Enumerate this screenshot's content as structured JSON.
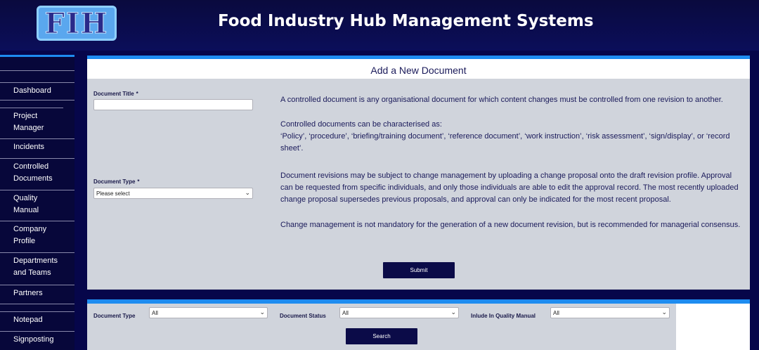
{
  "header": {
    "logo_text": "FIH",
    "title": "Food Industry Hub Management Systems"
  },
  "sidebar": {
    "items": [
      {
        "label": "Dashboard"
      },
      {
        "label": "Project Manager"
      },
      {
        "label": "Incidents"
      },
      {
        "label": "Controlled Documents"
      },
      {
        "label": "Quality Manual"
      },
      {
        "label": "Company Profile"
      },
      {
        "label": "Departments and Teams"
      },
      {
        "label": "Partners"
      },
      {
        "label": "Notepad"
      },
      {
        "label": "Signposting"
      }
    ]
  },
  "form": {
    "title": "Add a New Document",
    "doc_title_label": "Document Title",
    "doc_title_value": "",
    "doc_type_label": "Document Type",
    "doc_type_value": "Please select",
    "required_marker": "*",
    "info_p1": "A controlled document is any organisational document for which content changes must be controlled from one revision to another.",
    "info_p2a": "Controlled documents can be characterised as:",
    "info_p2b": "‘Policy’, ‘procedure’, ‘briefing/training document’, ‘reference document’, ‘work instruction’, ‘risk assessment’, ‘sign/display’, or ‘record sheet’.",
    "info_p3a": "Document revisions may be subject to change management by uploading a change proposal onto the draft revision profile. Approval can be requested from specific individuals, and only those individuals are able to edit the approval record. The most recently uploaded change proposal supersedes previous proposals, and approval can only be indicated for the most recent proposal.",
    "info_p3b": "Change management is not mandatory for the generation of a new document revision, but is recommended for managerial consensus.",
    "submit_label": "Submit"
  },
  "filters": {
    "doc_type_label": "Document Type",
    "doc_type_value": "All",
    "doc_status_label": "Document Status",
    "doc_status_value": "All",
    "quality_label": "Inlude In Quality Manual",
    "quality_value": "All",
    "search_label": "Search"
  },
  "colors": {
    "accent": "#1e8cf0",
    "navy": "#0b0b48",
    "panel": "#d0d4dc"
  }
}
